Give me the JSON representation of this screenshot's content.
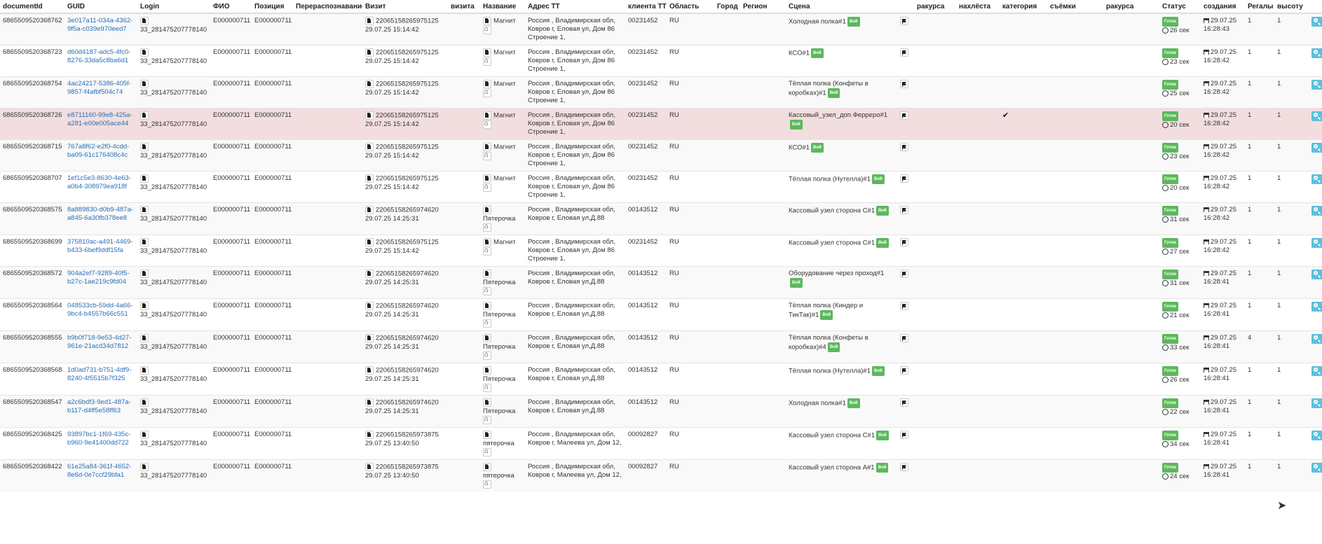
{
  "columns": [
    "documentId",
    "GUID",
    "Login",
    "ФИО",
    "Позиция",
    "Перераспознавание",
    "Визит",
    "визита",
    "Название",
    "Адрес ТТ",
    "клиента ТТ",
    "Область",
    "Город",
    "Регион",
    "Сцена",
    "",
    "ракурса",
    "нахлёста",
    "категория",
    "съёмки",
    "ракурса",
    "Статус",
    "создания",
    "Регалы",
    "высоту",
    ""
  ],
  "rows": [
    {
      "documentId": "6865509520368762",
      "guid1": "3e017a11-034a-4362-",
      "guid2": "9f5a-c039e970eed7",
      "login": "33_281475207778140",
      "fio": "E000000711",
      "position": "E000000711",
      "visit_id": "22065158265975125",
      "visit_date": "29.07.25 15:14:42",
      "name": "Магнит",
      "address": "Россия , Владимирская обл, Ковров г, Еловая ул, Дом 86 Строение 1,",
      "client": "00231452",
      "region": "RU",
      "scene": "Холодная полка#1",
      "scene_badge": "Вой",
      "check": "",
      "status": "Готов",
      "duration": "26 сек",
      "created_date": "29.07.25",
      "created_time": "16:28:43",
      "regaly": "1",
      "vysotu": "1"
    },
    {
      "documentId": "6865509520368723",
      "guid1": "d60d4187-adc5-4fc0-",
      "guid2": "8276-33da5c8ba6d1",
      "login": "33_281475207778140",
      "fio": "E000000711",
      "position": "E000000711",
      "visit_id": "22065158265975125",
      "visit_date": "29.07.25 15:14:42",
      "name": "Магнит",
      "address": "Россия , Владимирская обл, Ковров г, Еловая ул, Дом 86 Строение 1,",
      "client": "00231452",
      "region": "RU",
      "scene": "КСО#1",
      "scene_badge": "Вой",
      "check": "",
      "status": "Готов",
      "duration": "23 сек",
      "created_date": "29.07.25",
      "created_time": "16:28:42",
      "regaly": "1",
      "vysotu": "1"
    },
    {
      "documentId": "6865509520368754",
      "guid1": "4ac24217-5386-405f-",
      "guid2": "9857-f4afbf504c74",
      "login": "33_281475207778140",
      "fio": "E000000711",
      "position": "E000000711",
      "visit_id": "22065158265975125",
      "visit_date": "29.07.25 15:14:42",
      "name": "Магнит",
      "address": "Россия , Владимирская обл, Ковров г, Еловая ул, Дом 86 Строение 1,",
      "client": "00231452",
      "region": "RU",
      "scene": "Тёплая полка (Конфеты в коробках)#1",
      "scene_badge": "Вой",
      "check": "",
      "status": "Готов",
      "duration": "25 сек",
      "created_date": "29.07.25",
      "created_time": "16:28:42",
      "regaly": "1",
      "vysotu": "1"
    },
    {
      "documentId": "6865509520368726",
      "guid1": "e8711160-99e8-425a-",
      "guid2": "a281-e00e005ace44",
      "login": "33_281475207778140",
      "fio": "E000000711",
      "position": "E000000711",
      "visit_id": "22065158265975125",
      "visit_date": "29.07.25 15:14:42",
      "name": "Магнит",
      "address": "Россия , Владимирская обл, Ковров г, Еловая ул, Дом 86 Строение 1,",
      "client": "00231452",
      "region": "RU",
      "scene": "Кассовый_узел_доп.Ферреро#1",
      "scene_badge": "Вой",
      "check": "✔",
      "status": "Готов",
      "duration": "20 сек",
      "created_date": "29.07.25",
      "created_time": "16:28:42",
      "regaly": "1",
      "vysotu": "1",
      "highlight": true
    },
    {
      "documentId": "6865509520368715",
      "guid1": "767a8f62-e2f0-4cdd-",
      "guid2": "ba09-61c176408c4c",
      "login": "33_281475207778140",
      "fio": "E000000711",
      "position": "E000000711",
      "visit_id": "22065158265975125",
      "visit_date": "29.07.25 15:14:42",
      "name": "Магнит",
      "address": "Россия , Владимирская обл, Ковров г, Еловая ул, Дом 86 Строение 1,",
      "client": "00231452",
      "region": "RU",
      "scene": "КСО#1",
      "scene_badge": "Вой",
      "check": "",
      "status": "Готов",
      "duration": "23 сек",
      "created_date": "29.07.25",
      "created_time": "16:28:42",
      "regaly": "1",
      "vysotu": "1"
    },
    {
      "documentId": "6865509520368707",
      "guid1": "1ef1c5e3-8630-4e63-",
      "guid2": "a0b4-308979ea918f",
      "login": "33_281475207778140",
      "fio": "E000000711",
      "position": "E000000711",
      "visit_id": "22065158265975125",
      "visit_date": "29.07.25 15:14:42",
      "name": "Магнит",
      "address": "Россия , Владимирская обл, Ковров г, Еловая ул, Дом 86 Строение 1,",
      "client": "00231452",
      "region": "RU",
      "scene": "Тёплая полка (Нутелла)#1",
      "scene_badge": "Вой",
      "check": "",
      "status": "Готов",
      "duration": "20 сек",
      "created_date": "29.07.25",
      "created_time": "16:28:42",
      "regaly": "1",
      "vysotu": "1"
    },
    {
      "documentId": "6865509520368575",
      "guid1": "8a889830-d0b9-487a-",
      "guid2": "a845-6a30fb378ee8",
      "login": "33_281475207778140",
      "fio": "E000000711",
      "position": "E000000711",
      "visit_id": "22065158265974620",
      "visit_date": "29.07.25 14:25:31",
      "name": "Пятерочка",
      "address": "Россия , Владимирская обл, Ковров г, Еловая ул,Д.88",
      "client": "00143512",
      "region": "RU",
      "scene": "Кассовый узел сторона С#1",
      "scene_badge": "Вой",
      "check": "",
      "status": "Готов",
      "duration": "31 сек",
      "created_date": "29.07.25",
      "created_time": "16:28:42",
      "regaly": "1",
      "vysotu": "1"
    },
    {
      "documentId": "6865509520368699",
      "guid1": "375810ac-a491-4469-",
      "guid2": "b433-6bef9ddf15fa",
      "login": "33_281475207778140",
      "fio": "E000000711",
      "position": "E000000711",
      "visit_id": "22065158265975125",
      "visit_date": "29.07.25 15:14:42",
      "name": "Магнит",
      "address": "Россия , Владимирская обл, Ковров г, Еловая ул, Дом 86 Строение 1,",
      "client": "00231452",
      "region": "RU",
      "scene": "Кассовый узел сторона С#1",
      "scene_badge": "Вой",
      "check": "",
      "status": "Готов",
      "duration": "27 сек",
      "created_date": "29.07.25",
      "created_time": "16:28:42",
      "regaly": "1",
      "vysotu": "1"
    },
    {
      "documentId": "6865509520368572",
      "guid1": "904a2ef7-9289-40f5-",
      "guid2": "b27c-1ae219c9fd04",
      "login": "33_281475207778140",
      "fio": "E000000711",
      "position": "E000000711",
      "visit_id": "22065158265974620",
      "visit_date": "29.07.25 14:25:31",
      "name": "Пятерочка",
      "address": "Россия , Владимирская обл, Ковров г, Еловая ул,Д.88",
      "client": "00143512",
      "region": "RU",
      "scene": "Оборудование через проход#1",
      "scene_badge": "Вой",
      "check": "",
      "status": "Готов",
      "duration": "31 сек",
      "created_date": "29.07.25",
      "created_time": "16:28:41",
      "regaly": "1",
      "vysotu": "1"
    },
    {
      "documentId": "6865509520368564",
      "guid1": "048533cb-59dd-4a66-",
      "guid2": "9bc4-b4557b66c551",
      "login": "33_281475207778140",
      "fio": "E000000711",
      "position": "E000000711",
      "visit_id": "22065158265974620",
      "visit_date": "29.07.25 14:25:31",
      "name": "Пятерочка",
      "address": "Россия , Владимирская обл, Ковров г, Еловая ул,Д.88",
      "client": "00143512",
      "region": "RU",
      "scene": "Тёплая полка (Киндер и ТикТак)#1",
      "scene_badge": "Вой",
      "check": "",
      "status": "Готов",
      "duration": "21 сек",
      "created_date": "29.07.25",
      "created_time": "16:28:41",
      "regaly": "1",
      "vysotu": "1"
    },
    {
      "documentId": "6865509520368555",
      "guid1": "b9b0f718-9e53-4d27-",
      "guid2": "961e-21acd34d7812",
      "login": "33_281475207778140",
      "fio": "E000000711",
      "position": "E000000711",
      "visit_id": "22065158265974620",
      "visit_date": "29.07.25 14:25:31",
      "name": "Пятерочка",
      "address": "Россия , Владимирская обл, Ковров г, Еловая ул,Д.88",
      "client": "00143512",
      "region": "RU",
      "scene": "Тёплая полка (Конфеты в коробках)#4",
      "scene_badge": "Вой",
      "check": "",
      "status": "Готов",
      "duration": "33 сек",
      "created_date": "29.07.25",
      "created_time": "16:28:41",
      "regaly": "4",
      "vysotu": "1"
    },
    {
      "documentId": "6865509520368568",
      "guid1": "1d0ad731-b751-4df9-",
      "guid2": "8240-4f5515b7f325",
      "login": "33_281475207778140",
      "fio": "E000000711",
      "position": "E000000711",
      "visit_id": "22065158265974620",
      "visit_date": "29.07.25 14:25:31",
      "name": "Пятерочка",
      "address": "Россия , Владимирская обл, Ковров г, Еловая ул,Д.88",
      "client": "00143512",
      "region": "RU",
      "scene": "Тёплая полка (Нутелла)#1",
      "scene_badge": "Вой",
      "check": "",
      "status": "Готов",
      "duration": "26 сек",
      "created_date": "29.07.25",
      "created_time": "16:28:41",
      "regaly": "1",
      "vysotu": "1"
    },
    {
      "documentId": "6865509520368547",
      "guid1": "a2c6bdf3-9ed1-487a-",
      "guid2": "b117-d4ff5e58ff63",
      "login": "33_281475207778140",
      "fio": "E000000711",
      "position": "E000000711",
      "visit_id": "22065158265974620",
      "visit_date": "29.07.25 14:25:31",
      "name": "Пятерочка",
      "address": "Россия , Владимирская обл, Ковров г, Еловая ул,Д.88",
      "client": "00143512",
      "region": "RU",
      "scene": "Холодная полка#1",
      "scene_badge": "Вой",
      "check": "",
      "status": "Готов",
      "duration": "22 сек",
      "created_date": "29.07.25",
      "created_time": "16:28:41",
      "regaly": "1",
      "vysotu": "1"
    },
    {
      "documentId": "6865509520368425",
      "guid1": "93897bc1-1f69-435c-",
      "guid2": "b960-9e41400dd722",
      "login": "33_281475207778140",
      "fio": "E000000711",
      "position": "E000000711",
      "visit_id": "22065158265973875",
      "visit_date": "29.07.25 13:40:50",
      "name": "пятерочка",
      "address": "Россия , Владимирская обл, Ковров г, Малеева ул, Дом 12,",
      "client": "00092827",
      "region": "RU",
      "scene": "Кассовый узел сторона С#1",
      "scene_badge": "Вой",
      "check": "",
      "status": "Готов",
      "duration": "34 сек",
      "created_date": "29.07.25",
      "created_time": "16:28:41",
      "regaly": "1",
      "vysotu": "1"
    },
    {
      "documentId": "6865509520368422",
      "guid1": "61e25a84-361f-4652-",
      "guid2": "8e6d-0e7ccf29bfa1",
      "login": "33_281475207778140",
      "fio": "E000000711",
      "position": "E000000711",
      "visit_id": "22065158265973875",
      "visit_date": "29.07.25 13:40:50",
      "name": "пятерочка",
      "address": "Россия , Владимирская обл, Ковров г, Малеева ул, Дом 12,",
      "client": "00092827",
      "region": "RU",
      "scene": "Кассовый узел сторона А#1",
      "scene_badge": "Вой",
      "check": "",
      "status": "Готов",
      "duration": "24 сек",
      "created_date": "29.07.25",
      "created_time": "16:28:41",
      "regaly": "1",
      "vysotu": "1"
    }
  ],
  "colors": {
    "link": "#2a6fb7",
    "badge": "#5cb85c",
    "search_button": "#5bc0de",
    "highlight_row": "#f2dede"
  },
  "icons": {
    "doc": "document-icon",
    "home": "home-icon",
    "flag": "flag-icon",
    "calendar": "calendar-icon",
    "clock": "clock-icon",
    "search": "search-icon"
  }
}
